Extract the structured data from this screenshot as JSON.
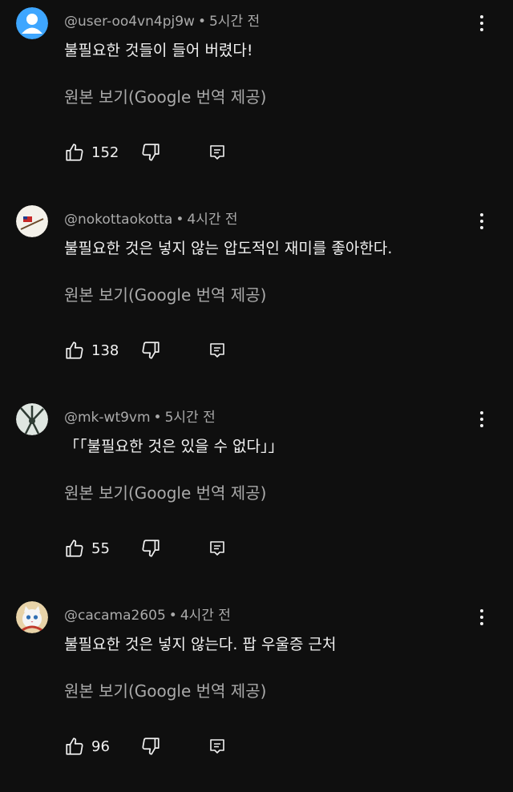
{
  "comments": [
    {
      "handle": "@user-oo4vn4pj9w",
      "time": "5시간 전",
      "text": "불필요한 것들이 들어 버렸다!",
      "translate": "원본 보기(Google 번역 제공)",
      "likes": "152",
      "avatar": "default-user-avatar"
    },
    {
      "handle": "@nokottaokotta",
      "time": "4시간 전",
      "text": "불필요한 것은 넣지 않는 압도적인 재미를 좋아한다.",
      "translate": "원본 보기(Google 번역 제공)",
      "likes": "138",
      "avatar": "flag-avatar"
    },
    {
      "handle": "@mk-wt9vm",
      "time": "5시간 전",
      "text": "「「불필요한 것은 있을 수 없다」」",
      "translate": "원본 보기(Google 번역 제공)",
      "likes": "55",
      "avatar": "tree-avatar"
    },
    {
      "handle": "@cacama2605",
      "time": "4시간 전",
      "text": "불필요한 것은 넣지 않는다. 팝 우울증 근처",
      "translate": "원본 보기(Google 번역 제공)",
      "likes": "96",
      "avatar": "cat-avatar"
    }
  ],
  "separator": "•",
  "colors": {
    "background": "#0f0f0f",
    "text": "#f1f1f1",
    "secondary": "#aaaaaa",
    "default_avatar": "#3ea6ff"
  }
}
